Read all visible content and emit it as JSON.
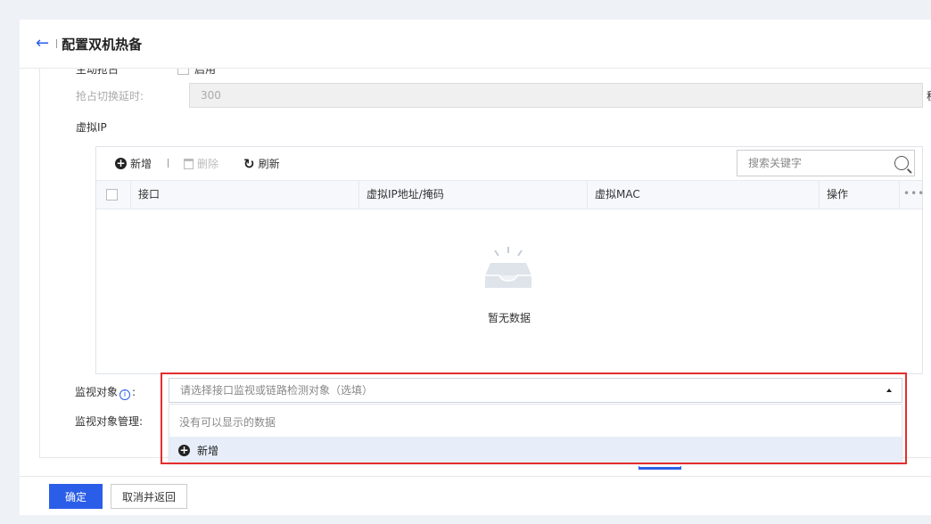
{
  "header": {
    "title": "配置双机热备"
  },
  "clipped_row": {
    "label": "主动抢占",
    "checkbox_label": "启用"
  },
  "preempt_delay": {
    "label": "抢占切换延时:",
    "value": "300",
    "unit": "秒"
  },
  "virtual_ip": {
    "section_label": "虚拟IP",
    "toolbar": {
      "add_label": "新增",
      "delete_label": "删除",
      "refresh_label": "刷新"
    },
    "search": {
      "placeholder": "搜索关键字"
    },
    "columns": [
      "接口",
      "虚拟IP地址/掩码",
      "虚拟MAC",
      "操作"
    ],
    "empty_text": "暂无数据"
  },
  "monitor": {
    "label": "监视对象",
    "colon": ":",
    "placeholder": "请选择接口监视或链路检测对象（选填）",
    "dropdown_empty": "没有可以显示的数据",
    "dropdown_add": "新增",
    "manage_label": "监视对象管理:"
  },
  "footer": {
    "confirm_label": "确定",
    "cancel_label": "取消并返回"
  },
  "colors": {
    "accent": "#2b5ee8",
    "highlight": "#e42d2d"
  }
}
